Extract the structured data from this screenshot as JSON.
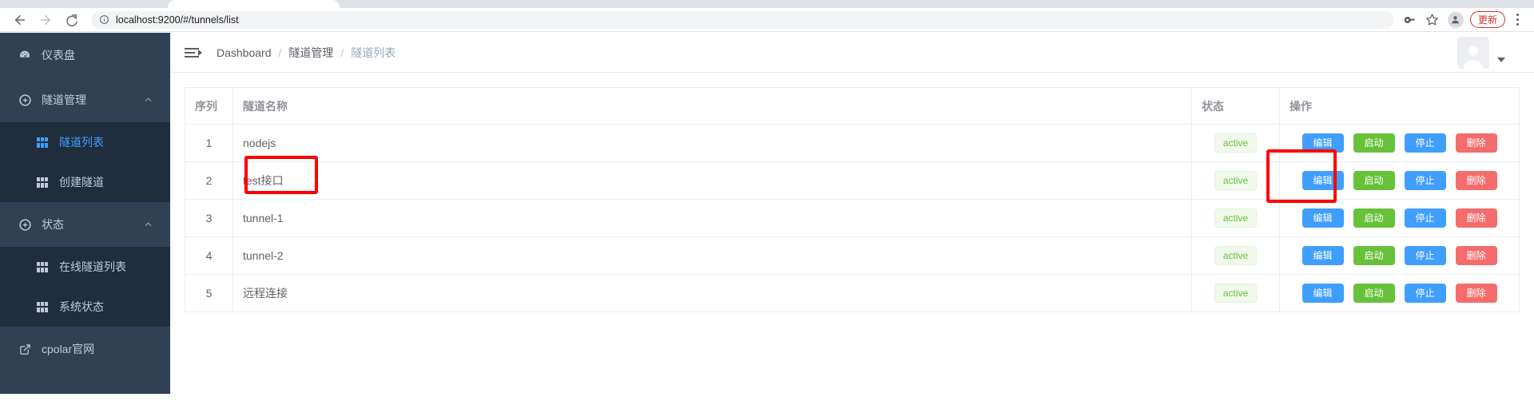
{
  "browser": {
    "back_icon": "back-arrow-icon",
    "forward_icon": "forward-arrow-icon",
    "reload_icon": "reload-icon",
    "site_info_icon": "info-circle-icon",
    "url": "localhost:9200/#/tunnels/list",
    "password_key_icon": "key-icon",
    "bookmark_icon": "star-icon",
    "profile_icon": "profile-avatar-icon",
    "update_label": "更新",
    "menu_icon": "three-dot-menu-icon"
  },
  "sidebar": {
    "items": [
      {
        "label": "仪表盘",
        "icon": "dashboard-icon",
        "type": "link",
        "active": false
      },
      {
        "label": "隧道管理",
        "icon": "compass-icon",
        "type": "group",
        "expanded": true
      },
      {
        "label": "隧道列表",
        "icon": "grid-icon",
        "type": "sub",
        "active": true
      },
      {
        "label": "创建隧道",
        "icon": "grid-icon",
        "type": "sub",
        "active": false
      },
      {
        "label": "状态",
        "icon": "compass-icon",
        "type": "group",
        "expanded": true
      },
      {
        "label": "在线隧道列表",
        "icon": "grid-icon",
        "type": "sub",
        "active": false
      },
      {
        "label": "系统状态",
        "icon": "grid-icon",
        "type": "sub",
        "active": false
      },
      {
        "label": "cpolar官网",
        "icon": "external-link-icon",
        "type": "link",
        "active": false
      }
    ]
  },
  "navbar": {
    "collapse_icon": "hamburger-collapse-icon",
    "breadcrumb": [
      {
        "label": "Dashboard",
        "current": false
      },
      {
        "label": "隧道管理",
        "current": false
      },
      {
        "label": "隧道列表",
        "current": true
      }
    ],
    "separator": "/",
    "avatar_icon": "user-avatar-icon",
    "avatar_caret_icon": "caret-down-icon"
  },
  "table": {
    "columns": {
      "seq": "序列",
      "name": "隧道名称",
      "state": "状态",
      "ops": "操作"
    },
    "rows": [
      {
        "seq": "1",
        "name": "nodejs",
        "state": "active"
      },
      {
        "seq": "2",
        "name": "test接口",
        "state": "active"
      },
      {
        "seq": "3",
        "name": "tunnel-1",
        "state": "active"
      },
      {
        "seq": "4",
        "name": "tunnel-2",
        "state": "active"
      },
      {
        "seq": "5",
        "name": "远程连接",
        "state": "active"
      }
    ],
    "buttons": {
      "edit": "编辑",
      "start": "启动",
      "stop": "停止",
      "delete": "删除"
    }
  },
  "colors": {
    "sidebar_bg": "#304156",
    "sidebar_sub_bg": "#1f2d3d",
    "accent_blue": "#409eff",
    "success_green": "#67c23a",
    "danger_red": "#f56c6c",
    "annotation_red": "#ff0000",
    "update_red": "#d93025"
  }
}
